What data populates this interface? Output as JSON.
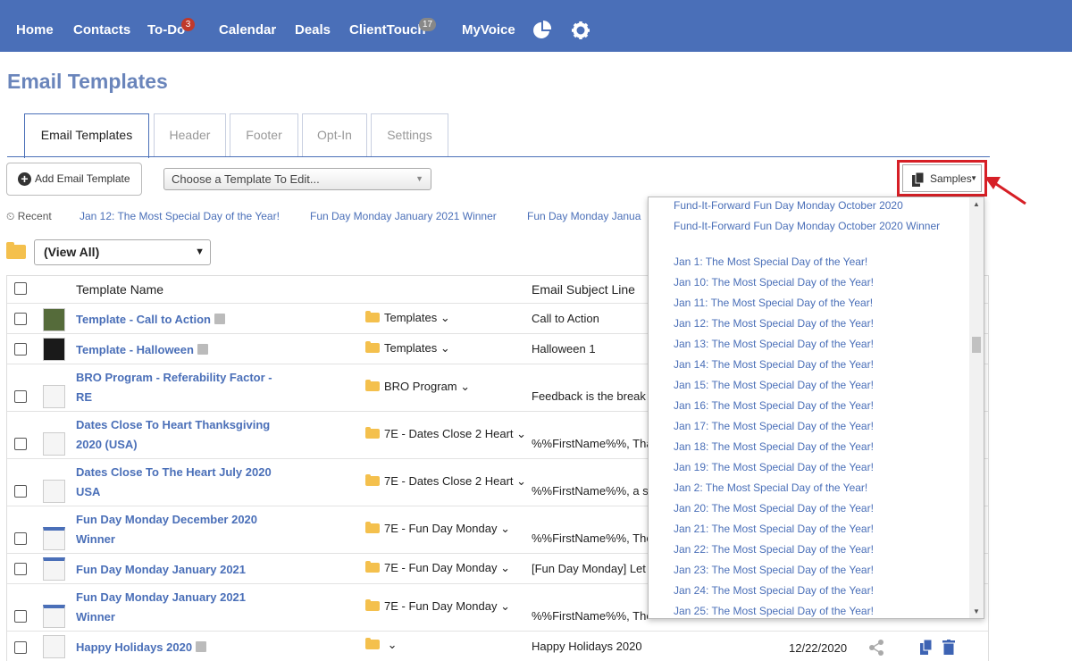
{
  "nav": {
    "items": [
      "Home",
      "Contacts",
      "To-Do",
      "Calendar",
      "Deals",
      "ClientTouch",
      "MyVoice"
    ],
    "todo_badge": "3",
    "clienttouch_badge": "17"
  },
  "page": {
    "title": "Email Templates"
  },
  "tabs": [
    "Email Templates",
    "Header",
    "Footer",
    "Opt-In",
    "Settings"
  ],
  "toolbar": {
    "add_label": "Add Email Template",
    "choose_label": "Choose a Template To Edit...",
    "samples_label": "Samples"
  },
  "recent": {
    "label": "Recent",
    "links": [
      "Jan 12: The Most Special Day of the Year!",
      "Fun Day Monday January 2021 Winner",
      "Fun Day Monday Janua"
    ]
  },
  "filter": {
    "selected": "(View All)"
  },
  "table": {
    "headers": {
      "name": "Template Name",
      "subject": "Email Subject Line"
    },
    "rows": [
      {
        "name": "Template - Call to Action",
        "folder": "Templates",
        "subject": "Call to Action",
        "date": ""
      },
      {
        "name": "Template - Halloween",
        "folder": "Templates",
        "subject": "Halloween 1",
        "date": ""
      },
      {
        "name": "BRO Program - Referability Factor - RE",
        "folder": "BRO Program",
        "subject": "Feedback is the break",
        "date": ""
      },
      {
        "name": "Dates Close To Heart Thanksgiving 2020 (USA)",
        "folder": "7E - Dates Close 2 Heart",
        "subject": "%%FirstName%%, Tha",
        "date": ""
      },
      {
        "name": "Dates Close To The Heart July 2020 USA",
        "folder": "7E - Dates Close 2 Heart",
        "subject": "%%FirstName%%, a sp",
        "date": ""
      },
      {
        "name": "Fun Day Monday December 2020 Winner",
        "folder": "7E - Fun Day Monday",
        "subject": "%%FirstName%%, The",
        "date": ""
      },
      {
        "name": "Fun Day Monday January 2021",
        "folder": "7E - Fun Day Monday",
        "subject": "[Fun Day Monday] Let",
        "date": ""
      },
      {
        "name": "Fun Day Monday January 2021 Winner",
        "folder": "7E - Fun Day Monday",
        "subject": "%%FirstName%%, The",
        "date": ""
      },
      {
        "name": "Happy Holidays 2020",
        "folder": "",
        "subject": "Happy Holidays 2020",
        "date": "12/22/2020"
      }
    ]
  },
  "samples_dropdown": [
    "Fund-It-Forward Fun Day Monday October 2020",
    "Fund-It-Forward Fun Day Monday October 2020 Winner",
    "Jan 1: The Most Special Day of the Year!",
    "Jan 10: The Most Special Day of the Year!",
    "Jan 11: The Most Special Day of the Year!",
    "Jan 12: The Most Special Day of the Year!",
    "Jan 13: The Most Special Day of the Year!",
    "Jan 14: The Most Special Day of the Year!",
    "Jan 15: The Most Special Day of the Year!",
    "Jan 16: The Most Special Day of the Year!",
    "Jan 17: The Most Special Day of the Year!",
    "Jan 18: The Most Special Day of the Year!",
    "Jan 19: The Most Special Day of the Year!",
    "Jan 2: The Most Special Day of the Year!",
    "Jan 20: The Most Special Day of the Year!",
    "Jan 21: The Most Special Day of the Year!",
    "Jan 22: The Most Special Day of the Year!",
    "Jan 23: The Most Special Day of the Year!",
    "Jan 24: The Most Special Day of the Year!",
    "Jan 25: The Most Special Day of the Year!"
  ],
  "colors": {
    "nav": "#4a6fb8",
    "link": "#4a6fb8",
    "highlight": "#d61f26",
    "folder": "#f4c04d"
  }
}
